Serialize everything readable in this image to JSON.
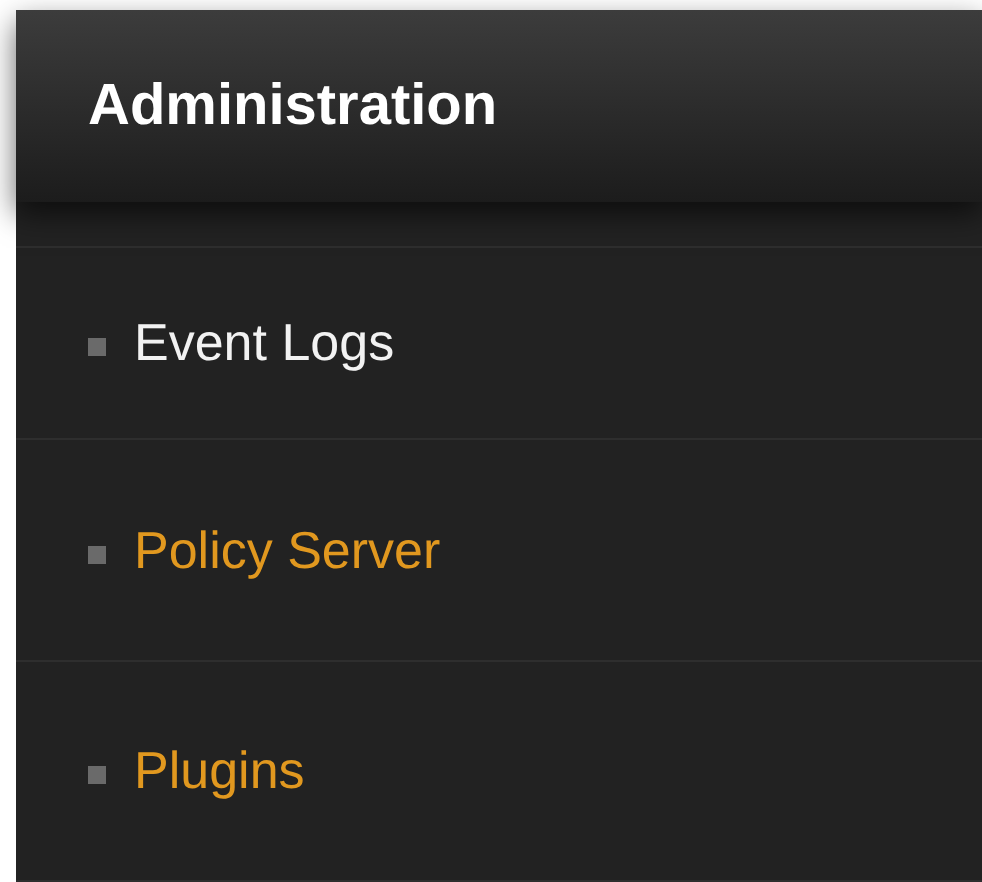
{
  "panel": {
    "title": "Administration"
  },
  "items": [
    {
      "label": "Event Logs",
      "selected": true
    },
    {
      "label": "Policy Server",
      "selected": false
    },
    {
      "label": "Plugins",
      "selected": false
    }
  ]
}
